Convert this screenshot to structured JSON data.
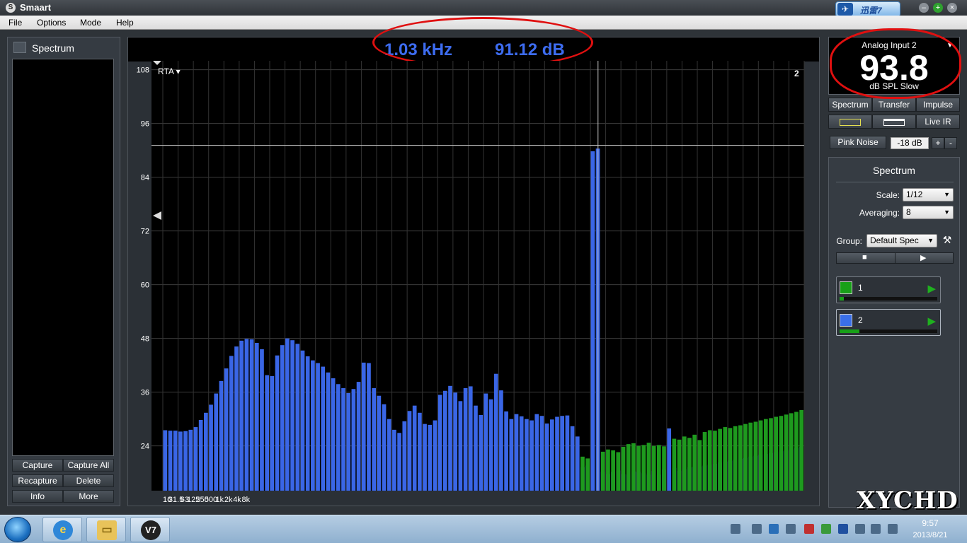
{
  "window": {
    "title": "Smaart"
  },
  "xunlei": {
    "label": "迅雷7"
  },
  "menu": [
    "File",
    "Options",
    "Mode",
    "Help"
  ],
  "left_panel": {
    "title": "Spectrum",
    "buttons": [
      "Capture",
      "Capture All",
      "Recapture",
      "Delete",
      "Info",
      "More"
    ]
  },
  "readout": {
    "frequency": "1.03 kHz",
    "level": "91.12 dB"
  },
  "plot": {
    "mode_label": "RTA ▾",
    "trace_number": "2"
  },
  "meter": {
    "source": "Analog Input 2",
    "value": "93.8",
    "unit": "dB SPL Slow"
  },
  "tabs": [
    "Spectrum",
    "Transfer",
    "Impulse"
  ],
  "live_ir": "Live IR",
  "generator": {
    "label": "Pink Noise",
    "level": "-18 dB",
    "plus": "+",
    "minus": "-"
  },
  "control": {
    "title": "Spectrum",
    "scale_label": "Scale:",
    "scale_value": "1/12",
    "averaging_label": "Averaging:",
    "averaging_value": "8",
    "group_label": "Group:",
    "group_value": "Default Spec"
  },
  "measurements": [
    {
      "name": "1",
      "color": "#18a018",
      "level": 0.04
    },
    {
      "name": "2",
      "color": "#3a6fe8",
      "level": 0.2
    }
  ],
  "clock": {
    "time": "9:57",
    "date": "2013/8/21"
  },
  "watermark": "XYCHD",
  "chart_data": {
    "type": "bar",
    "ylim": [
      14,
      110
    ],
    "y_ticks": [
      108,
      96,
      84,
      72,
      60,
      48,
      36,
      24
    ],
    "x_tick_labels": [
      "16",
      "31.5",
      "63",
      "125",
      "250",
      "500",
      "1k",
      "2k",
      "4k",
      "8k"
    ],
    "crosshair": {
      "frequency_khz": 1.03,
      "level_db": 91.12
    },
    "series": [
      {
        "name": "2",
        "color": "#3a66e6",
        "values": [
          27.5,
          27.4,
          27.4,
          27.2,
          27.3,
          27.6,
          28.2,
          29.8,
          31.4,
          33.2,
          35.7,
          38.5,
          41.3,
          44.1,
          46.2,
          47.5,
          47.9,
          47.8,
          47.0,
          45.6,
          39.8,
          39.6,
          44.2,
          46.5,
          48.0,
          47.6,
          46.8,
          45.3,
          44.0,
          43.1,
          42.5,
          41.7,
          40.4,
          39.1,
          37.8,
          36.9,
          35.8,
          36.7,
          38.3,
          42.6,
          42.5,
          36.9,
          35.2,
          33.3,
          30.0,
          27.6,
          26.9,
          29.5,
          31.8,
          33.0,
          31.4,
          28.9,
          28.7,
          29.7,
          35.4,
          36.3,
          37.4,
          35.9,
          34.0,
          36.9,
          37.3,
          33.0,
          30.9,
          35.7,
          34.4,
          40.1,
          36.4,
          31.7,
          30.0,
          31.1,
          30.6,
          30.0,
          29.7,
          31.1,
          30.7,
          29.0,
          29.9,
          30.5,
          30.7,
          30.8,
          28.4,
          26.1,
          19.2,
          19.6,
          89.8,
          90.4,
          18.2,
          17.7,
          18.2,
          18.5,
          17.7,
          17.6,
          18.3,
          18.2,
          17.9,
          17.6,
          18.4,
          17.6,
          18.7,
          27.9,
          19.1,
          18.4,
          18.8,
          19.2,
          19.3,
          19.4,
          19.6,
          19.8,
          20.0,
          20.3,
          20.5,
          20.7,
          20.9,
          21.1,
          21.3,
          21.6,
          21.8,
          22.0,
          22.2,
          22.4,
          22.6,
          22.8,
          23.0,
          23.2,
          23.5,
          23.8
        ]
      },
      {
        "name": "1",
        "color": "#1e9a1e",
        "values": [
          0,
          0,
          0,
          0,
          0,
          0,
          0,
          0,
          0,
          0,
          0,
          0,
          0,
          0,
          0,
          0,
          0,
          0,
          0,
          0,
          0,
          0,
          0,
          0,
          0,
          0,
          0,
          0,
          0,
          0,
          0,
          0,
          0,
          0,
          0,
          0,
          0,
          0,
          0,
          0,
          0,
          0,
          0,
          0,
          0,
          0,
          0,
          0,
          0,
          0,
          0,
          0,
          0,
          0,
          0,
          0,
          0,
          0,
          0,
          0,
          0,
          0,
          0,
          0,
          0,
          0,
          0,
          0,
          0,
          0,
          0,
          0,
          0,
          0,
          0,
          0,
          0,
          0,
          0,
          0,
          0,
          0,
          21.6,
          21.2,
          0,
          0,
          22.7,
          23.2,
          23.0,
          22.6,
          23.8,
          24.4,
          24.6,
          24.0,
          24.2,
          24.7,
          24.0,
          24.2,
          23.9,
          0,
          25.6,
          25.4,
          26.1,
          25.8,
          26.5,
          25.3,
          27.1,
          27.5,
          27.4,
          27.8,
          28.2,
          28.0,
          28.4,
          28.6,
          28.9,
          29.2,
          29.4,
          29.7,
          30.0,
          30.2,
          30.5,
          30.7,
          31.0,
          31.3,
          31.6,
          32.0
        ]
      }
    ]
  }
}
